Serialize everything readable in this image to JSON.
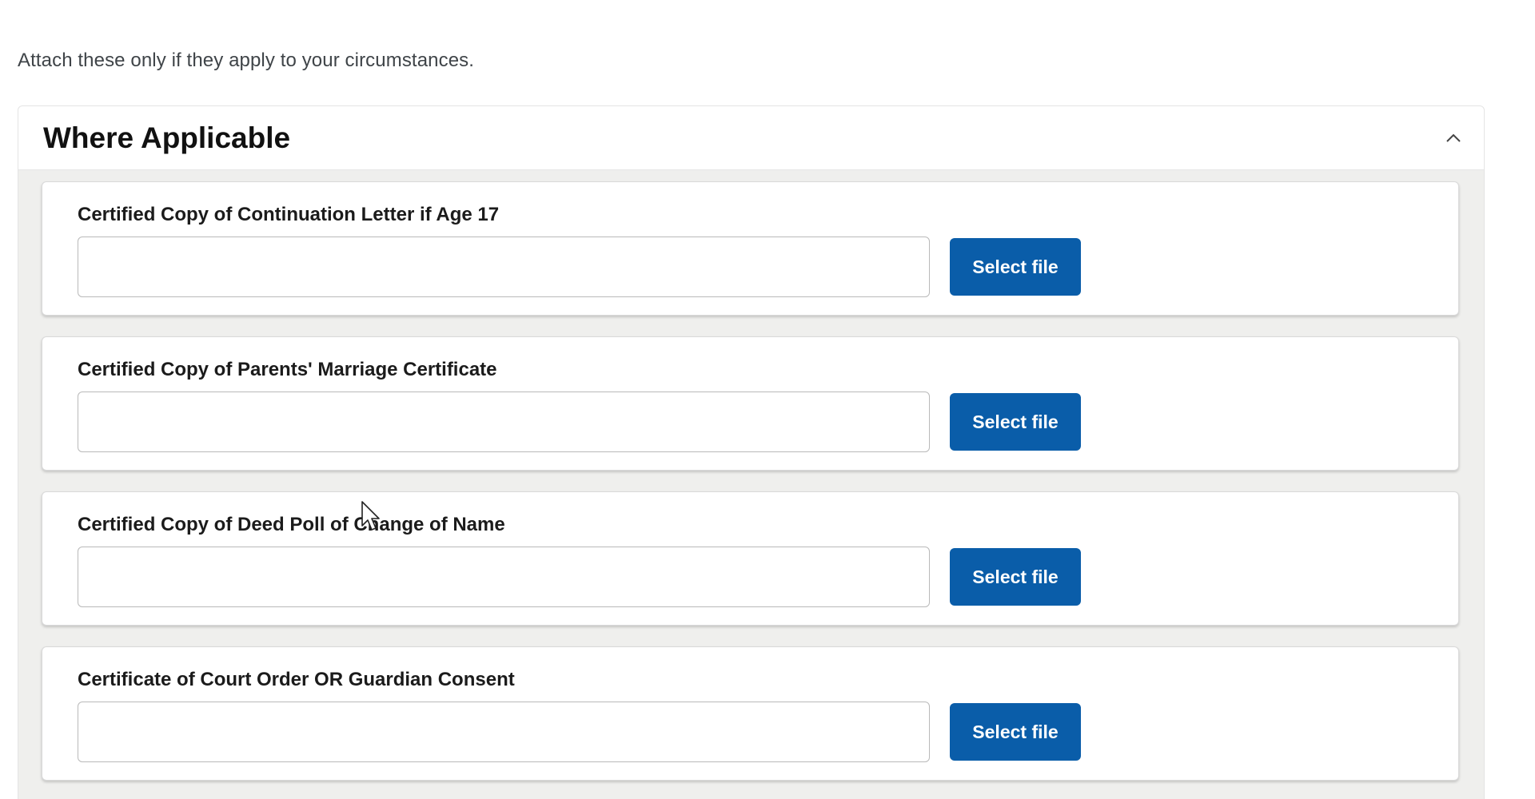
{
  "intro_text": "Attach these only if they apply to your circumstances.",
  "section": {
    "title": "Where Applicable",
    "expanded": true,
    "toggle_icon": "chevron-up-icon"
  },
  "documents": [
    {
      "label": "Certified Copy of Continuation Letter if Age 17",
      "value": "",
      "button": "Select file"
    },
    {
      "label": "Certified Copy of Parents' Marriage Certificate",
      "value": "",
      "button": "Select file"
    },
    {
      "label": "Certified Copy of Deed Poll of Change of Name",
      "value": "",
      "button": "Select file"
    },
    {
      "label": "Certificate of Court Order OR Guardian Consent",
      "value": "",
      "button": "Select file"
    }
  ],
  "colors": {
    "button_bg": "#0a5da9",
    "section_bg": "#efefed"
  }
}
